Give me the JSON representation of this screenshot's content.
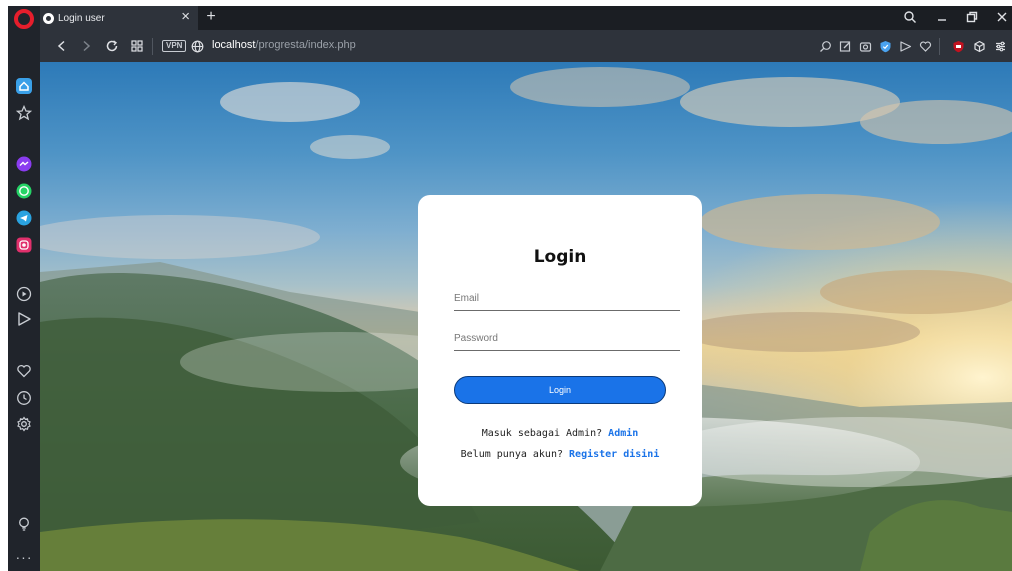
{
  "browser": {
    "tab": {
      "title": "Login user",
      "favicon": "opera-page-icon",
      "close_label": "×"
    },
    "new_tab_label": "+",
    "address": {
      "vpn_label": "VPN",
      "url_host": "localhost",
      "url_path": "/progresta/index.php"
    },
    "sidebar": {
      "items": [
        "home-icon",
        "star-icon",
        "messenger-icon",
        "whatsapp-icon",
        "telegram-icon",
        "instagram-icon",
        "player-icon",
        "flow-icon",
        "heart-icon",
        "history-icon",
        "settings-icon",
        "tips-icon"
      ],
      "more_label": "···"
    },
    "colors": {
      "opera_red": "#e61e2c",
      "sidebar_bg": "#20242b",
      "toolbar_bg": "#2e333b"
    }
  },
  "login": {
    "title": "Login",
    "email_placeholder": "Email",
    "password_placeholder": "Password",
    "button_label": "Login",
    "admin_prompt": "Masuk sebagai Admin?",
    "admin_link": "Admin",
    "register_prompt": "Belum punya akun?",
    "register_link": "Register disini",
    "accent_color": "#1a73e8"
  }
}
